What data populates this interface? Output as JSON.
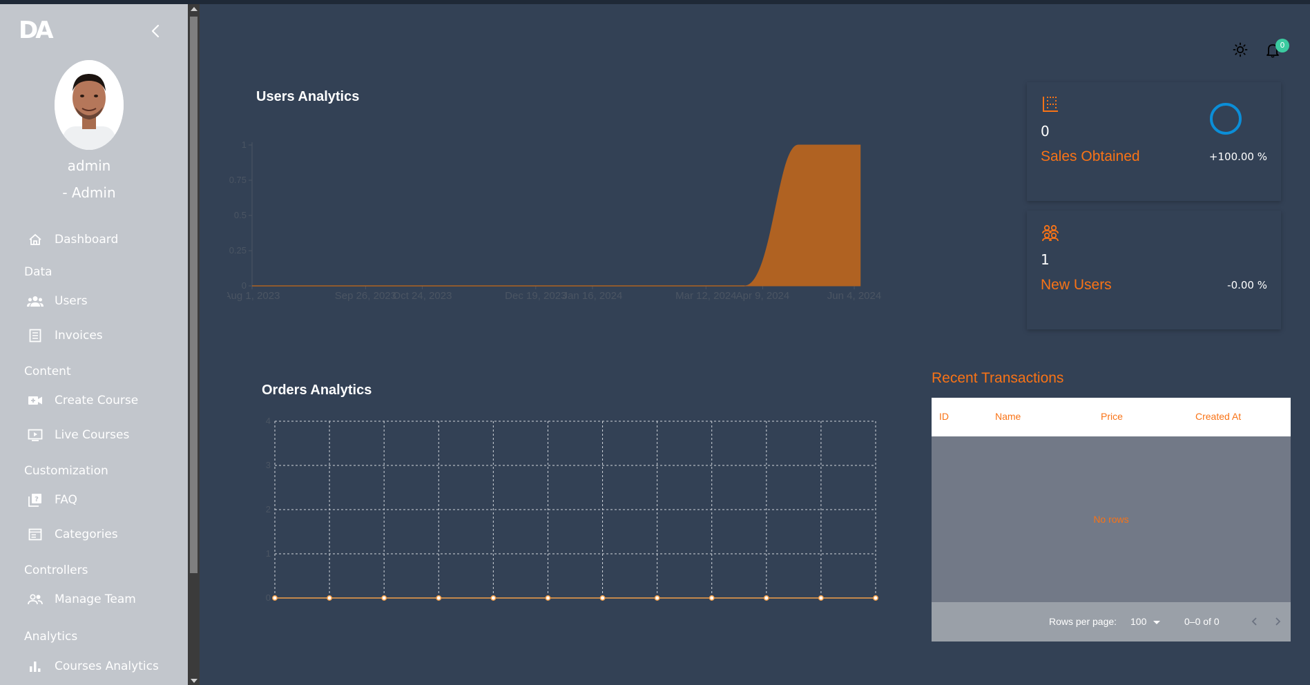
{
  "app": {
    "logo_text": "DA"
  },
  "user": {
    "name": "admin",
    "role": "- Admin"
  },
  "sidebar": {
    "items": [
      {
        "label": "Dashboard"
      },
      {
        "section": "Data"
      },
      {
        "label": "Users"
      },
      {
        "label": "Invoices"
      },
      {
        "section": "Content"
      },
      {
        "label": "Create Course"
      },
      {
        "label": "Live Courses"
      },
      {
        "section": "Customization"
      },
      {
        "label": "FAQ"
      },
      {
        "label": "Categories"
      },
      {
        "section": "Controllers"
      },
      {
        "label": "Manage Team"
      },
      {
        "section": "Analytics"
      },
      {
        "label": "Courses Analytics"
      }
    ]
  },
  "header": {
    "notifications_count": "0"
  },
  "users_chart": {
    "title": "Users Analytics",
    "chart_data": {
      "type": "area",
      "x": [
        "Aug 1, 2023",
        "Sep 26, 2023",
        "Oct 24, 2023",
        "Dec 19, 2023",
        "Jan 16, 2024",
        "Mar 12, 2024",
        "Apr 9, 2024",
        "Jun 4, 2024"
      ],
      "xtick_labels": [
        "Aug 1, 2023",
        "Sep 26, 2023",
        "Oct 24, 2023",
        "Dec 19, 2023",
        "Jan 16, 2024",
        "Mar 12, 2024",
        "Apr 9, 2024",
        "Jun 4, 2024"
      ],
      "series": [
        {
          "values": [
            0,
            0,
            0,
            0,
            0,
            0,
            0,
            1
          ]
        }
      ],
      "ytick_labels": [
        "0",
        "0.25",
        "0.5",
        "0.75",
        "1"
      ],
      "ylim": [
        0,
        1
      ],
      "fill_color": "#b06222"
    }
  },
  "orders_chart": {
    "title": "Orders Analytics",
    "chart_data": {
      "type": "line",
      "series": [
        {
          "values": [
            0,
            0,
            0,
            0,
            0,
            0,
            0,
            0,
            0,
            0,
            0,
            0
          ]
        }
      ],
      "ytick_labels": [
        "0",
        "1",
        "2",
        "3",
        "4"
      ],
      "ylim": [
        0,
        4
      ],
      "grid": true,
      "color": "#f5a04a"
    }
  },
  "stats": [
    {
      "value": "0",
      "label": "Sales Obtained",
      "percent": "+100.00 %",
      "icon": "grid-icon"
    },
    {
      "value": "1",
      "label": "New Users",
      "percent": "-0.00 %",
      "icon": "users-icon"
    }
  ],
  "transactions": {
    "title": "Recent Transactions",
    "columns": [
      "ID",
      "Name",
      "Price",
      "Created At"
    ],
    "empty_text": "No rows",
    "rows_per_page_label": "Rows per page:",
    "rows_per_page_value": "100",
    "range_text": "0–0 of 0"
  },
  "colors": {
    "accent": "#f97316",
    "bg": "#334155",
    "sidebar": "#c2c6cc"
  }
}
